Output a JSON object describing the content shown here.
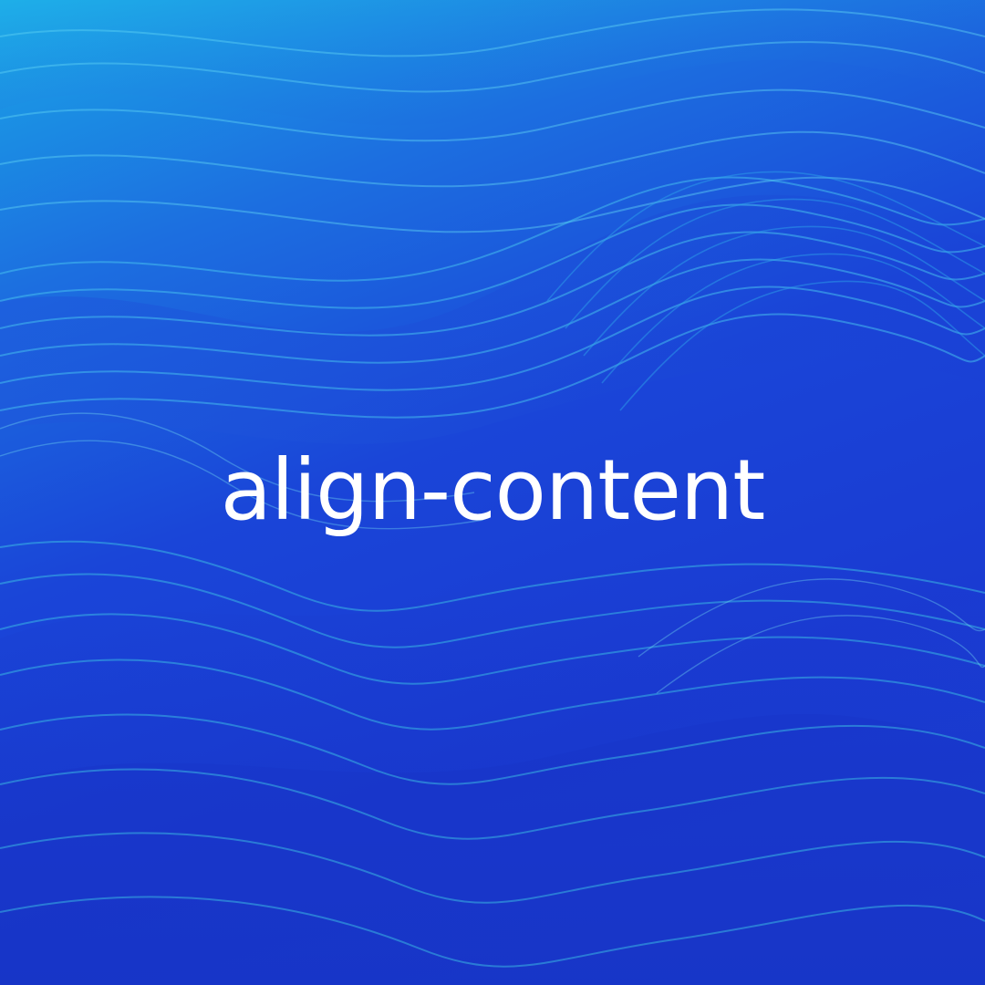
{
  "background": {
    "style": "abstract flowing 3D waves",
    "colors": {
      "top_left": "#1aa6e6",
      "mid": "#1a45d8",
      "deep": "#1a3bd2",
      "highlight": "#3fd0e8"
    }
  },
  "title": {
    "text": "align-content",
    "color": "#ffffff"
  }
}
